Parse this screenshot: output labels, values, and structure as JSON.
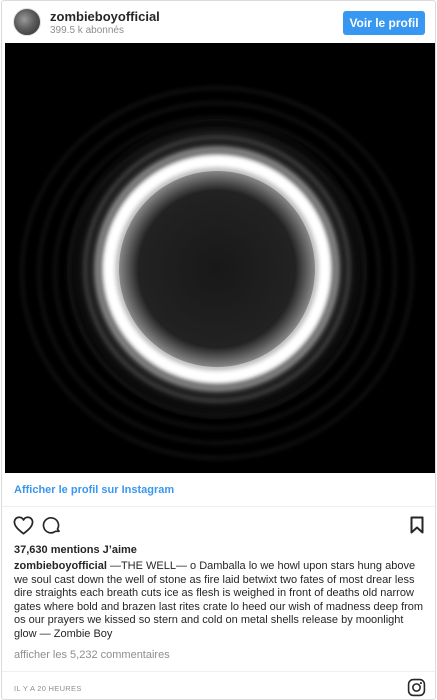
{
  "header": {
    "username": "zombieboyofficial",
    "followers": "399.5 k abonnés",
    "follow_button": "Voir le profil"
  },
  "post": {
    "view_profile_link": "Afficher le profil sur Instagram",
    "likes": "37,630 mentions J’aime",
    "caption_user": "zombieboyofficial",
    "caption_text": " —THE WELL— o Damballa lo we howl upon stars hung above we soul cast down the well of stone as fire laid betwixt two fates of most drear less dire straights each breath cuts ice as flesh is weighed in front of deaths old narrow gates where bold and brazen last rites crate lo heed our wish of madness deep from os our prayers we kissed so stern and cold on metal shells release by moonlight glow — Zombie Boy",
    "comments_link": "afficher les 5,232 commentaires",
    "timestamp": "IL Y A 20 HEURES"
  },
  "icons": {
    "like": "heart-icon",
    "comment": "comment-icon",
    "save": "bookmark-icon",
    "brand": "instagram-icon"
  },
  "colors": {
    "accent": "#3897f0",
    "text": "#262626",
    "muted": "#8e8e8e"
  }
}
